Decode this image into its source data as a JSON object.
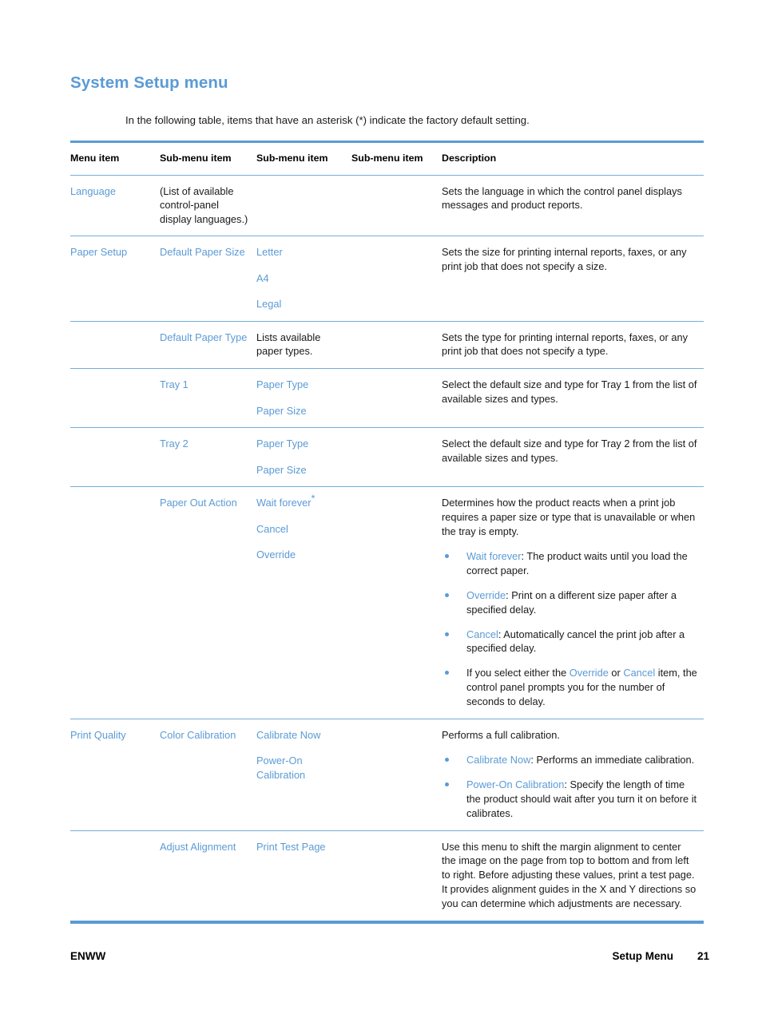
{
  "page": {
    "title": "System Setup menu",
    "intro": "In the following table, items that have an asterisk (*) indicate the factory default setting."
  },
  "table": {
    "headers": {
      "col1": "Menu item",
      "col2": "Sub-menu item",
      "col3": "Sub-menu item",
      "col4": "Sub-menu item",
      "col5": "Description"
    },
    "rows": [
      {
        "menu_item": "Language",
        "sub1": "(List of available control-panel display languages.)",
        "sub2": "",
        "sub3": "",
        "description": "Sets the language in which the control panel displays messages and product reports."
      },
      {
        "menu_item": "Paper Setup",
        "sub1": "Default Paper Size",
        "sub2_list": [
          "Letter",
          "A4",
          "Legal"
        ],
        "sub3": "",
        "description": "Sets the size for printing internal reports, faxes, or any print job that does not specify a size."
      },
      {
        "menu_item": "",
        "sub1": "Default Paper Type",
        "sub2": "Lists available paper types.",
        "sub3": "",
        "description": "Sets the type for printing internal reports, faxes, or any print job that does not specify a type."
      },
      {
        "menu_item": "",
        "sub1": "Tray 1",
        "sub2_list": [
          "Paper Type",
          "Paper Size"
        ],
        "sub3": "",
        "description": "Select the default size and type for Tray 1 from the list of available sizes and types."
      },
      {
        "menu_item": "",
        "sub1": "Tray 2",
        "sub2_list": [
          "Paper Type",
          "Paper Size"
        ],
        "sub3": "",
        "description": "Select the default size and type for Tray 2 from the list of available sizes and types."
      },
      {
        "menu_item": "",
        "sub1": "Paper Out Action",
        "sub2_list": [
          "Wait forever*",
          "Cancel",
          "Override"
        ],
        "sub3": "",
        "description_intro": "Determines how the product reacts when a print job requires a paper size or type that is unavailable or when the tray is empty.",
        "bullets": [
          {
            "term": "Wait forever",
            "sep": ": ",
            "text": "The product waits until you load the correct paper."
          },
          {
            "term": "Override",
            "sep": ": ",
            "text": "Print on a different size paper after a specified delay."
          },
          {
            "term": "Cancel",
            "sep": ": ",
            "text": "Automatically cancel the print job after a specified delay."
          },
          {
            "prefix": "If you select either the ",
            "term": "Override",
            "mid": " or ",
            "term2": "Cancel",
            "text": " item, the control panel prompts you for the number of seconds to delay."
          }
        ]
      },
      {
        "menu_item": "Print Quality",
        "sub1": "Color Calibration",
        "sub2_list": [
          "Calibrate Now",
          "Power-On Calibration"
        ],
        "sub3": "",
        "description_intro": "Performs a full calibration.",
        "bullets": [
          {
            "term": "Calibrate Now",
            "sep": ": ",
            "text": "Performs an immediate calibration."
          },
          {
            "term": "Power-On Calibration",
            "sep": ": ",
            "text": "Specify the length of time the product should wait after you turn it on before it calibrates."
          }
        ]
      },
      {
        "menu_item": "",
        "sub1": "Adjust Alignment",
        "sub2": "Print Test Page",
        "sub3": "",
        "description": "Use this menu to shift the margin alignment to center the image on the page from top to bottom and from left to right. Before adjusting these values, print a test page. It provides alignment guides in the X and Y directions so you can determine which adjustments are necessary."
      }
    ]
  },
  "footer": {
    "left": "ENWW",
    "section": "Setup Menu",
    "page_number": "21"
  },
  "colors": {
    "accent_blue": "#5b9bd5",
    "rule_blue": "#72aed9",
    "body_text": "#1a1a1a"
  }
}
